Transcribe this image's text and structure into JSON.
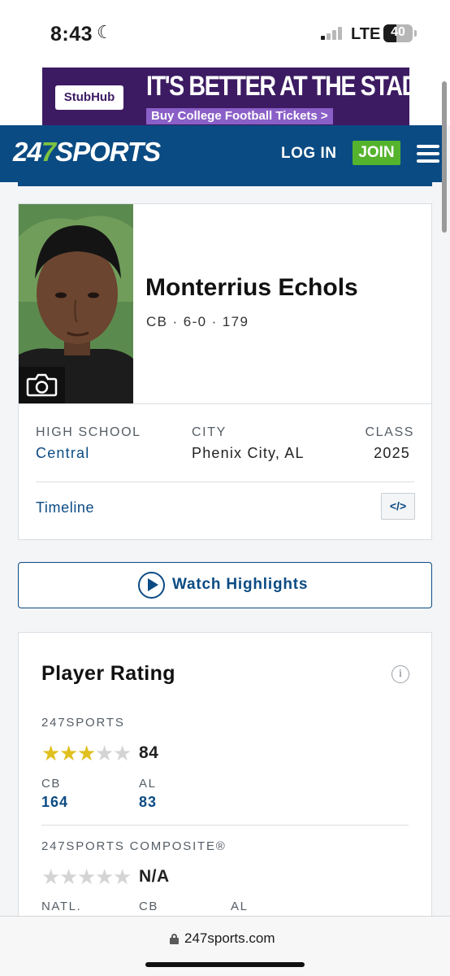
{
  "status_bar": {
    "time": "8:43",
    "moon_glyph": "☾",
    "network": "LTE",
    "battery": "40"
  },
  "ad": {
    "brand": "StubHub",
    "headline": "IT'S BETTER AT THE STADIUM",
    "cta": "Buy College Football Tickets >"
  },
  "navbar": {
    "logo_prefix": "24",
    "logo_seven": "7",
    "logo_suffix": "SPORTS",
    "login_label": "LOG IN",
    "join_label": "JOIN",
    "colors": {
      "primary": "#0b4b83",
      "join": "#55b32d"
    }
  },
  "player": {
    "name": "Monterrius Echols",
    "meta": "CB · 6-0 · 179",
    "high_school_label": "HIGH SCHOOL",
    "high_school": "Central",
    "city_label": "CITY",
    "city": "Phenix City, AL",
    "class_label": "CLASS",
    "class": "2025",
    "timeline_label": "Timeline",
    "embed_label": "</>"
  },
  "highlights": {
    "label": "Watch Highlights"
  },
  "rating": {
    "title": "Player Rating",
    "info_glyph": "i",
    "sports247": {
      "label": "247SPORTS",
      "stars_filled": 3,
      "stars_total": 5,
      "score": "84",
      "ranks": [
        {
          "label": "CB",
          "value": "164"
        },
        {
          "label": "AL",
          "value": "83"
        }
      ]
    },
    "composite": {
      "label": "247SPORTS COMPOSITE®",
      "stars_filled": 0,
      "stars_total": 5,
      "score": "N/A",
      "rank_labels": [
        "NATL.",
        "CB",
        "AL"
      ]
    }
  },
  "browser": {
    "url": "247sports.com"
  }
}
